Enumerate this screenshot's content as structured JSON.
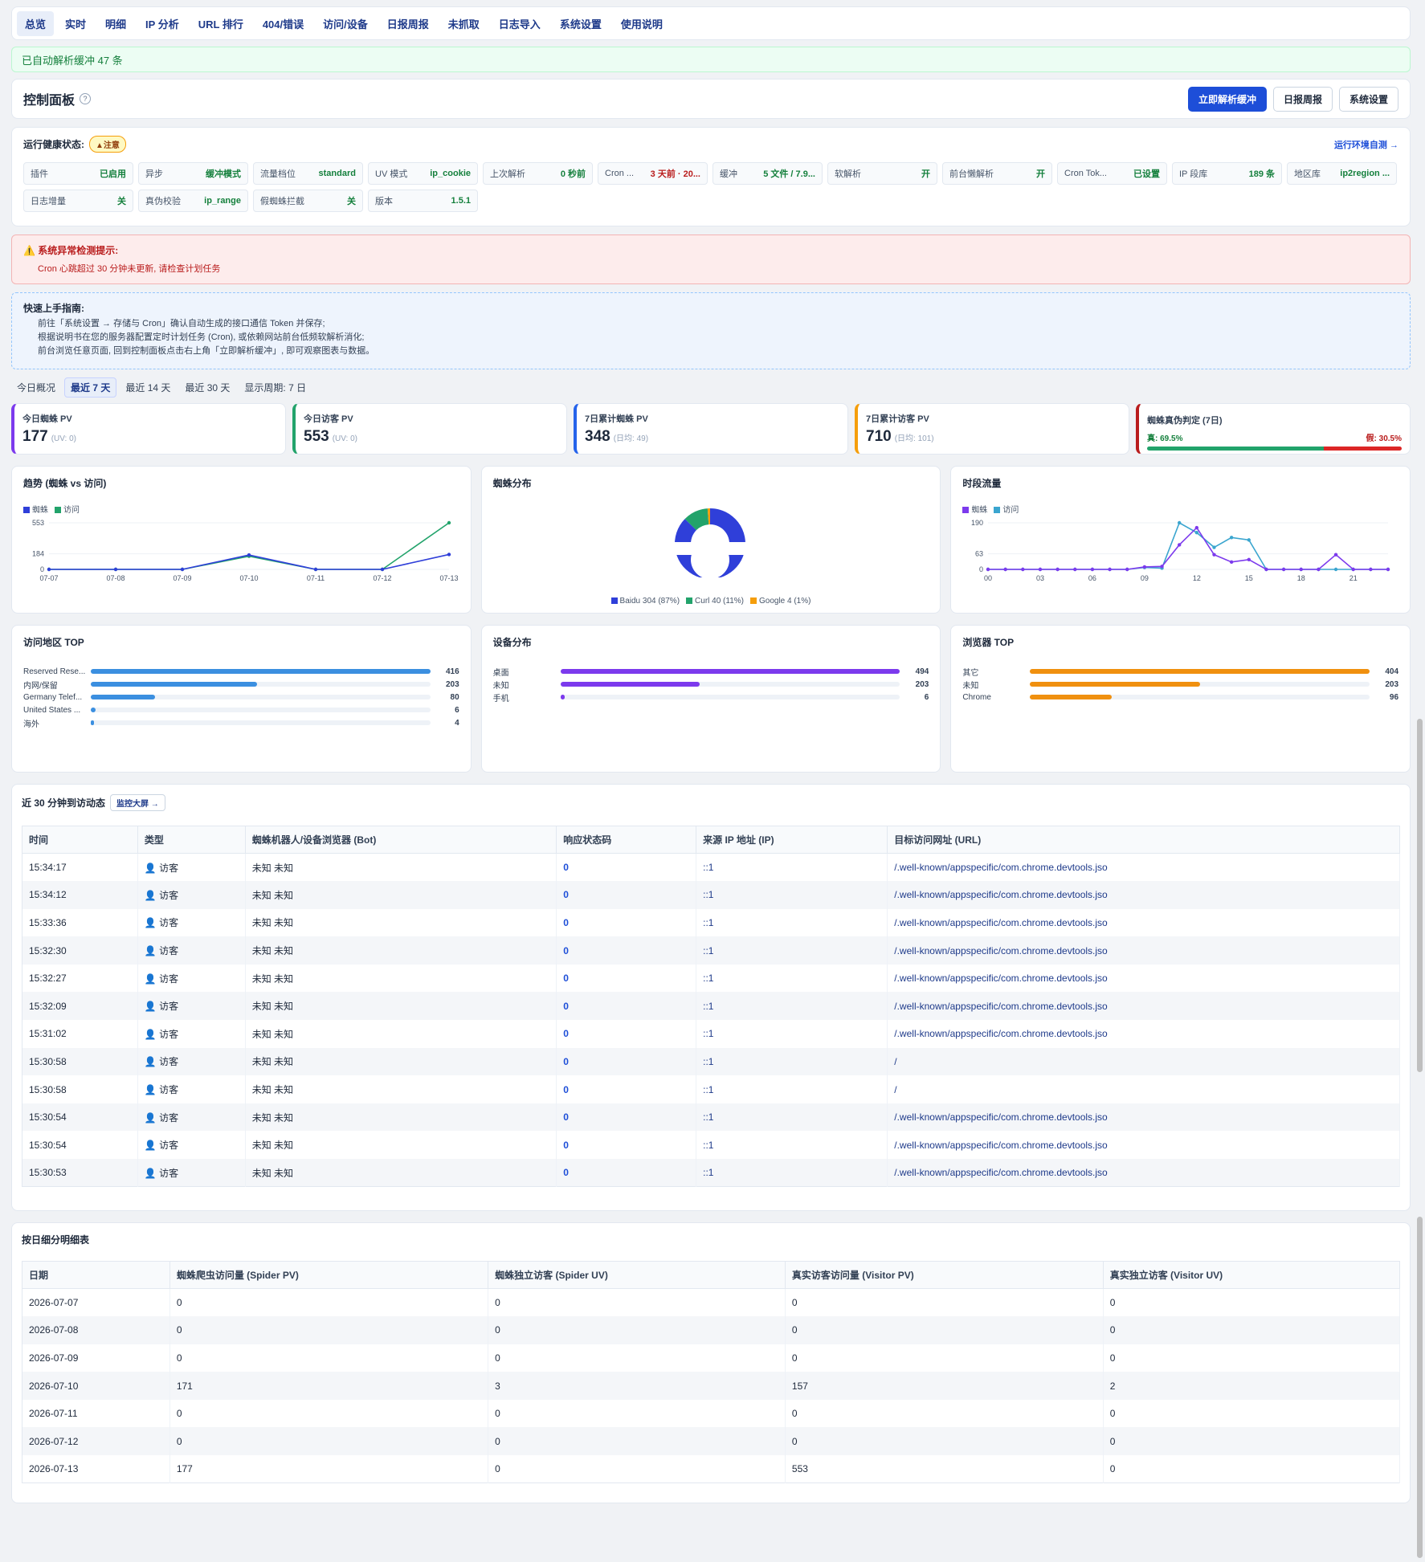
{
  "nav": {
    "tabs": [
      "总览",
      "实时",
      "明细",
      "IP 分析",
      "URL 排行",
      "404/错误",
      "访问/设备",
      "日报周报",
      "未抓取",
      "日志导入",
      "系统设置",
      "使用说明"
    ]
  },
  "notice": "已自动解析缓冲 47 条",
  "control": {
    "title": "控制面板",
    "help": "?",
    "parse_btn": "立即解析缓冲",
    "report_btn": "日报周报",
    "settings_btn": "系统设置"
  },
  "health": {
    "label": "运行健康状态:",
    "badge": "▲注意",
    "link": "运行环境自测 →",
    "chips": [
      {
        "k": "插件",
        "v": "已启用",
        "c": "green"
      },
      {
        "k": "异步",
        "v": "缓冲模式",
        "c": "green"
      },
      {
        "k": "流量档位",
        "v": "standard",
        "c": "green"
      },
      {
        "k": "UV 模式",
        "v": "ip_cookie",
        "c": "green"
      },
      {
        "k": "上次解析",
        "v": "0 秒前",
        "c": "green"
      },
      {
        "k": "Cron ...",
        "v": "3 天前 · 20...",
        "c": "red"
      },
      {
        "k": "缓冲",
        "v": "5 文件 / 7.9...",
        "c": "green"
      },
      {
        "k": "软解析",
        "v": "开",
        "c": "green"
      },
      {
        "k": "前台懒解析",
        "v": "开",
        "c": "green"
      },
      {
        "k": "Cron Tok...",
        "v": "已设置",
        "c": "green"
      },
      {
        "k": "IP 段库",
        "v": "189 条",
        "c": "green"
      },
      {
        "k": "地区库",
        "v": "ip2region ...",
        "c": "green"
      },
      {
        "k": "日志增量",
        "v": "关",
        "c": "green"
      },
      {
        "k": "真伪校验",
        "v": "ip_range",
        "c": "green"
      },
      {
        "k": "假蜘蛛拦截",
        "v": "关",
        "c": "green"
      },
      {
        "k": "版本",
        "v": "1.5.1",
        "c": "green"
      }
    ]
  },
  "alert": {
    "title": "系统异常检测提示:",
    "msg": "Cron 心跳超过 30 分钟未更新, 请检查计划任务"
  },
  "guide": {
    "title": "快速上手指南:",
    "lines": [
      "前往「系统设置 → 存储与 Cron」确认自动生成的接口通信 Token 并保存;",
      "根据说明书在您的服务器配置定时计划任务 (Cron), 或依赖网站前台低频软解析消化;",
      "前台浏览任意页面, 回到控制面板点击右上角「立即解析缓冲」, 即可观察图表与数据。"
    ]
  },
  "period": {
    "items": [
      "今日概况",
      "最近 7 天",
      "最近 14 天",
      "最近 30 天"
    ],
    "display": "显示周期: 7 日"
  },
  "kpis": [
    {
      "label": "今日蜘蛛 PV",
      "value": "177",
      "sub": "(UV: 0)",
      "color": "#7c3aed"
    },
    {
      "label": "今日访客 PV",
      "value": "553",
      "sub": "(UV: 0)",
      "color": "#22a36b"
    },
    {
      "label": "7日累计蜘蛛 PV",
      "value": "348",
      "sub": "(日均: 49)",
      "color": "#2563eb"
    },
    {
      "label": "7日累计访客 PV",
      "value": "710",
      "sub": "(日均: 101)",
      "color": "#f59e0b"
    }
  ],
  "truth": {
    "label": "蜘蛛真伪判定 (7日)",
    "true_label": "真: 69.5%",
    "false_label": "假: 30.5%",
    "true_share": 69.5,
    "color": "#b91c1c"
  },
  "trend": {
    "title": "趋势 (蜘蛛 vs 访问)",
    "legend": [
      "蜘蛛",
      "访问"
    ],
    "yticks": [
      "553",
      "184",
      "0"
    ],
    "xticks": [
      "07-07",
      "07-08",
      "07-09",
      "07-10",
      "07-11",
      "07-12",
      "07-13"
    ]
  },
  "spider": {
    "title": "蜘蛛分布",
    "legend": [
      "Baidu 304 (87%)",
      "Curl 40 (11%)",
      "Google 4 (1%)"
    ]
  },
  "hourly": {
    "title": "时段流量",
    "legend": [
      "蜘蛛",
      "访问"
    ],
    "yticks": [
      "190",
      "63",
      "0"
    ],
    "xticks": [
      "00",
      "03",
      "06",
      "09",
      "12",
      "15",
      "18",
      "21"
    ]
  },
  "chart_data": [
    {
      "type": "line",
      "title": "趋势 (蜘蛛 vs 访问)",
      "x": [
        "07-07",
        "07-08",
        "07-09",
        "07-10",
        "07-11",
        "07-12",
        "07-13"
      ],
      "series": [
        {
          "name": "蜘蛛",
          "values": [
            0,
            0,
            0,
            171,
            0,
            0,
            177
          ]
        },
        {
          "name": "访问",
          "values": [
            0,
            0,
            0,
            157,
            0,
            0,
            553
          ]
        }
      ],
      "ylim": [
        0,
        553
      ],
      "legend": "top-left",
      "colors": [
        "#2f3fd9",
        "#22a36b"
      ]
    },
    {
      "type": "pie",
      "title": "蜘蛛分布",
      "categories": [
        "Baidu",
        "Curl",
        "Google"
      ],
      "values": [
        304,
        40,
        4
      ],
      "colors": [
        "#2f3fd9",
        "#22a36b",
        "#f59e0b"
      ]
    },
    {
      "type": "line",
      "title": "时段流量",
      "x": [
        "00",
        "01",
        "02",
        "03",
        "04",
        "05",
        "06",
        "07",
        "08",
        "09",
        "10",
        "11",
        "12",
        "13",
        "14",
        "15",
        "16",
        "17",
        "18",
        "19",
        "20",
        "21",
        "22",
        "23"
      ],
      "series": [
        {
          "name": "蜘蛛",
          "values": [
            0,
            0,
            0,
            0,
            0,
            0,
            0,
            0,
            0,
            10,
            12,
            100,
            170,
            60,
            30,
            40,
            0,
            0,
            0,
            0,
            60,
            0,
            0,
            0
          ]
        },
        {
          "name": "访问",
          "values": [
            0,
            0,
            0,
            0,
            0,
            0,
            0,
            0,
            0,
            8,
            5,
            190,
            150,
            90,
            130,
            120,
            0,
            0,
            0,
            0,
            0,
            0,
            0,
            0
          ]
        }
      ],
      "ylim": [
        0,
        190
      ],
      "legend": "top-left",
      "colors": [
        "#7c3aed",
        "#3aa5cf"
      ]
    }
  ],
  "region": {
    "title": "访问地区 TOP",
    "color": "#3b8fe0",
    "rows": [
      {
        "n": "Reserved Rese...",
        "v": 416,
        "p": 100
      },
      {
        "n": "内网/保留",
        "v": 203,
        "p": 49
      },
      {
        "n": "Germany Telef...",
        "v": 80,
        "p": 19
      },
      {
        "n": "United States ...",
        "v": 6,
        "p": 1.5
      },
      {
        "n": "海外",
        "v": 4,
        "p": 1
      }
    ]
  },
  "device": {
    "title": "设备分布",
    "color": "#7c3aed",
    "rows": [
      {
        "n": "桌面",
        "v": 494,
        "p": 100
      },
      {
        "n": "未知",
        "v": 203,
        "p": 41
      },
      {
        "n": "手机",
        "v": 6,
        "p": 1.2
      }
    ]
  },
  "browser": {
    "title": "浏览器 TOP",
    "color": "#f0900f",
    "rows": [
      {
        "n": "其它",
        "v": 404,
        "p": 100
      },
      {
        "n": "未知",
        "v": 203,
        "p": 50
      },
      {
        "n": "Chrome",
        "v": 96,
        "p": 24
      }
    ]
  },
  "recent": {
    "title": "近 30 分钟到访动态",
    "pill": "监控大屏 →",
    "headers": [
      "时间",
      "类型",
      "蜘蛛机器人/设备浏览器 (Bot)",
      "响应状态码",
      "来源 IP 地址 (IP)",
      "目标访问网址 (URL)"
    ],
    "rows": [
      [
        "15:34:17",
        "👤 访客",
        "未知 未知",
        "0",
        "::1",
        "/.well-known/appspecific/com.chrome.devtools.jso"
      ],
      [
        "15:34:12",
        "👤 访客",
        "未知 未知",
        "0",
        "::1",
        "/.well-known/appspecific/com.chrome.devtools.jso"
      ],
      [
        "15:33:36",
        "👤 访客",
        "未知 未知",
        "0",
        "::1",
        "/.well-known/appspecific/com.chrome.devtools.jso"
      ],
      [
        "15:32:30",
        "👤 访客",
        "未知 未知",
        "0",
        "::1",
        "/.well-known/appspecific/com.chrome.devtools.jso"
      ],
      [
        "15:32:27",
        "👤 访客",
        "未知 未知",
        "0",
        "::1",
        "/.well-known/appspecific/com.chrome.devtools.jso"
      ],
      [
        "15:32:09",
        "👤 访客",
        "未知 未知",
        "0",
        "::1",
        "/.well-known/appspecific/com.chrome.devtools.jso"
      ],
      [
        "15:31:02",
        "👤 访客",
        "未知 未知",
        "0",
        "::1",
        "/.well-known/appspecific/com.chrome.devtools.jso"
      ],
      [
        "15:30:58",
        "👤 访客",
        "未知 未知",
        "0",
        "::1",
        "/"
      ],
      [
        "15:30:58",
        "👤 访客",
        "未知 未知",
        "0",
        "::1",
        "/"
      ],
      [
        "15:30:54",
        "👤 访客",
        "未知 未知",
        "0",
        "::1",
        "/.well-known/appspecific/com.chrome.devtools.jso"
      ],
      [
        "15:30:54",
        "👤 访客",
        "未知 未知",
        "0",
        "::1",
        "/.well-known/appspecific/com.chrome.devtools.jso"
      ],
      [
        "15:30:53",
        "👤 访客",
        "未知 未知",
        "0",
        "::1",
        "/.well-known/appspecific/com.chrome.devtools.jso"
      ]
    ]
  },
  "daily": {
    "title": "按日细分明细表",
    "headers": [
      "日期",
      "蜘蛛爬虫访问量 (Spider PV)",
      "蜘蛛独立访客 (Spider UV)",
      "真实访客访问量 (Visitor PV)",
      "真实独立访客 (Visitor UV)"
    ],
    "rows": [
      [
        "2026-07-07",
        "0",
        "0",
        "0",
        "0"
      ],
      [
        "2026-07-08",
        "0",
        "0",
        "0",
        "0"
      ],
      [
        "2026-07-09",
        "0",
        "0",
        "0",
        "0"
      ],
      [
        "2026-07-10",
        "171",
        "3",
        "157",
        "2"
      ],
      [
        "2026-07-11",
        "0",
        "0",
        "0",
        "0"
      ],
      [
        "2026-07-12",
        "0",
        "0",
        "0",
        "0"
      ],
      [
        "2026-07-13",
        "177",
        "0",
        "553",
        "0"
      ]
    ]
  }
}
